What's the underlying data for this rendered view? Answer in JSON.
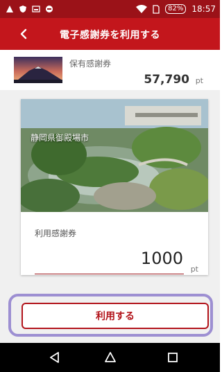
{
  "status_bar": {
    "battery": "82%",
    "time": "18:57"
  },
  "header": {
    "title": "電子感謝券を利用する"
  },
  "balance": {
    "label": "保有感謝券",
    "value": "57,790",
    "unit": "pt"
  },
  "voucher": {
    "location": "静岡県御殿場市",
    "amount_label": "利用感謝券",
    "amount": "1000",
    "unit": "pt"
  },
  "actions": {
    "use_label": "利用する"
  },
  "colors": {
    "primary": "#c3161c",
    "status_bar": "#9b1218",
    "highlight": "#9d8fd2"
  }
}
